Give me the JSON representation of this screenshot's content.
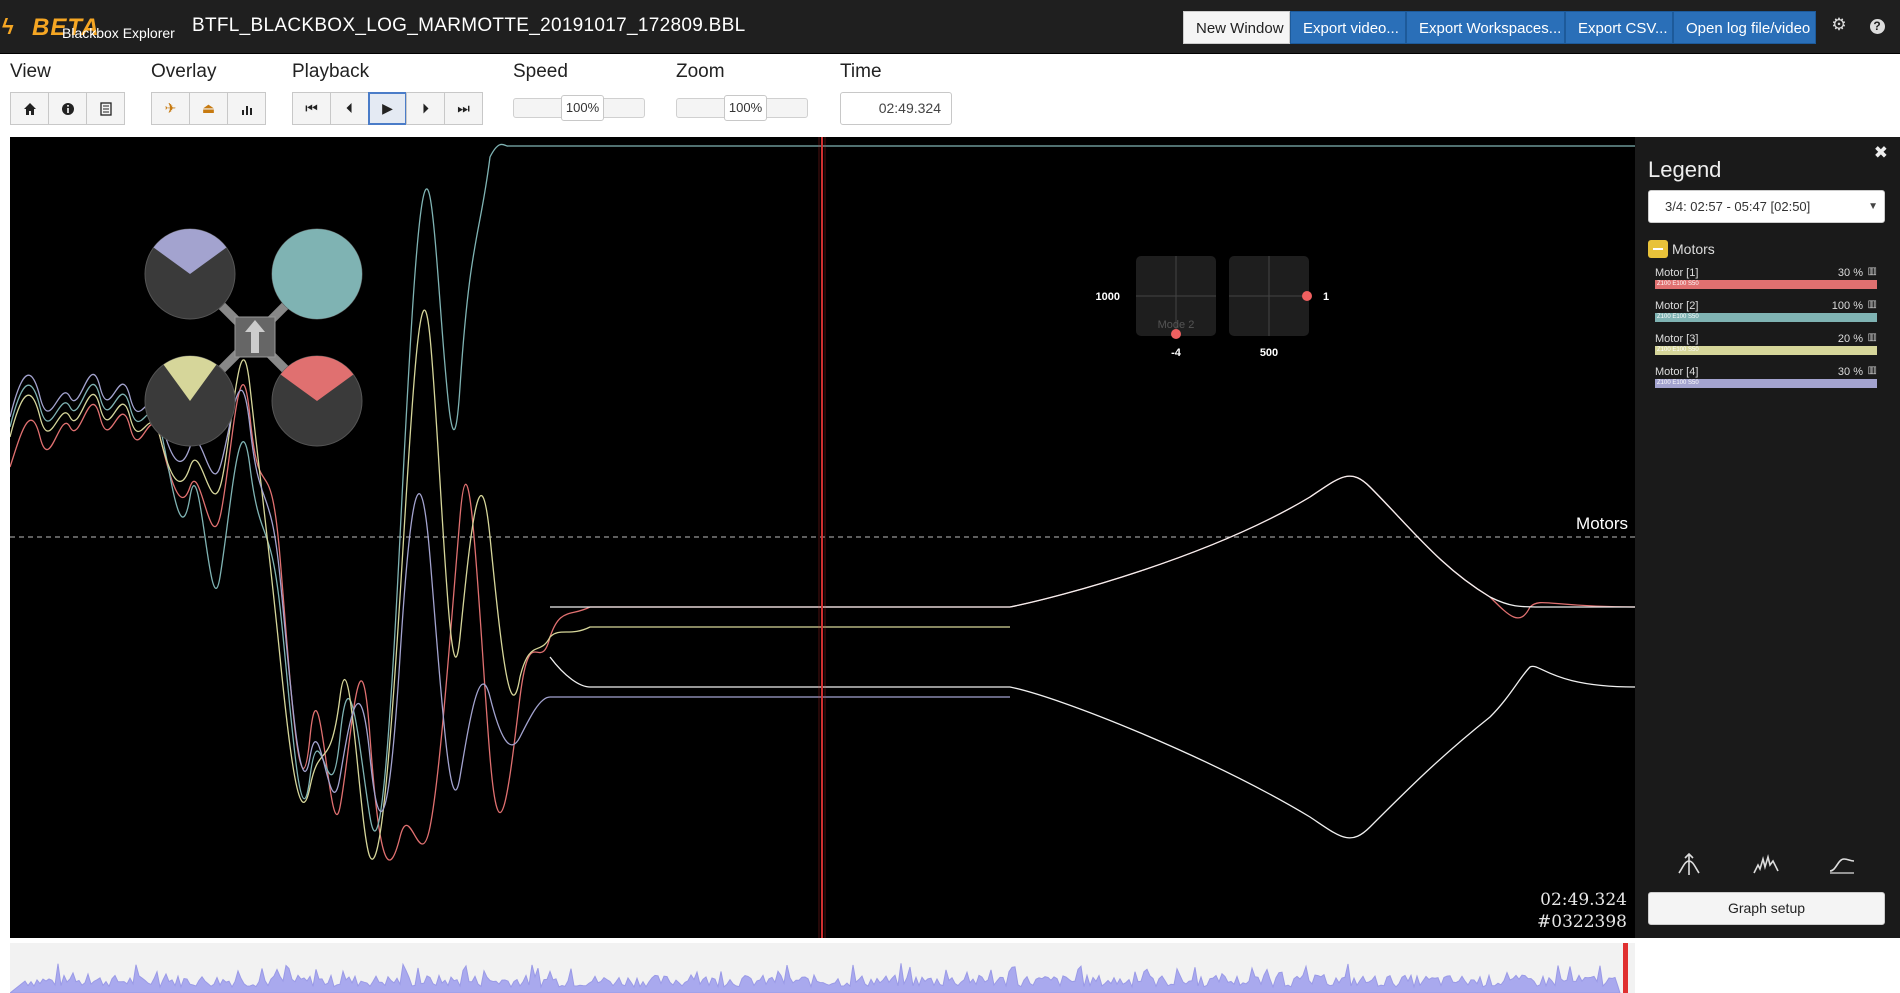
{
  "app": {
    "logo_beta": "BETA",
    "logo_sub": "Blackbox Explorer",
    "file_title": "BTFL_BLACKBOX_LOG_MARMOTTE_20191017_172809.BBL"
  },
  "header_buttons": {
    "new_window": "New Window",
    "export_video": "Export video...",
    "export_workspaces": "Export Workspaces...",
    "export_csv": "Export CSV...",
    "open_log": "Open log file/video"
  },
  "toolbar": {
    "view_label": "View",
    "overlay_label": "Overlay",
    "playback_label": "Playback",
    "speed_label": "Speed",
    "zoom_label": "Zoom",
    "time_label": "Time",
    "speed_value": "100%",
    "zoom_value": "100%",
    "time_value": "02:49.324"
  },
  "graph": {
    "group_label": "Motors",
    "time": "02:49.324",
    "frame": "#0322398",
    "stick_left_label": "1000",
    "stick_left_bottom": "-4",
    "stick_mode": "Mode 2",
    "stick_right_label": "1",
    "stick_right_bottom": "500",
    "stick_left_value": {
      "x": 0,
      "y": -1
    },
    "stick_right_value": {
      "x": 1,
      "y": 0
    }
  },
  "legend": {
    "title": "Legend",
    "close_glyph": "✖",
    "selected_log": "3/4: 02:57 - 05:47 [02:50]",
    "group_name": "Motors",
    "bar_text": "Z100 E100 S50",
    "items": [
      {
        "name": "Motor [1]",
        "value": "30 %",
        "color": "#e07070"
      },
      {
        "name": "Motor [2]",
        "value": "100 %",
        "color": "#7fb3b3"
      },
      {
        "name": "Motor [3]",
        "value": "20 %",
        "color": "#d6d69a"
      },
      {
        "name": "Motor [4]",
        "value": "30 %",
        "color": "#a3a3cf"
      }
    ],
    "graph_setup": "Graph setup"
  },
  "quad": {
    "motor_levels": [
      0.3,
      1.0,
      0.2,
      0.3
    ],
    "motor_colors": [
      "#e07070",
      "#7fb3b3",
      "#d6d69a",
      "#a3a3cf"
    ]
  },
  "chart_data": {
    "type": "line",
    "title": "",
    "series": [
      {
        "name": "Motor [1]",
        "color": "#e07070"
      },
      {
        "name": "Motor [2]",
        "color": "#7fb3b3"
      },
      {
        "name": "Motor [3]",
        "color": "#d6d69a"
      },
      {
        "name": "Motor [4]",
        "color": "#a3a3cf"
      }
    ],
    "cursor_time": "02:49.324"
  }
}
